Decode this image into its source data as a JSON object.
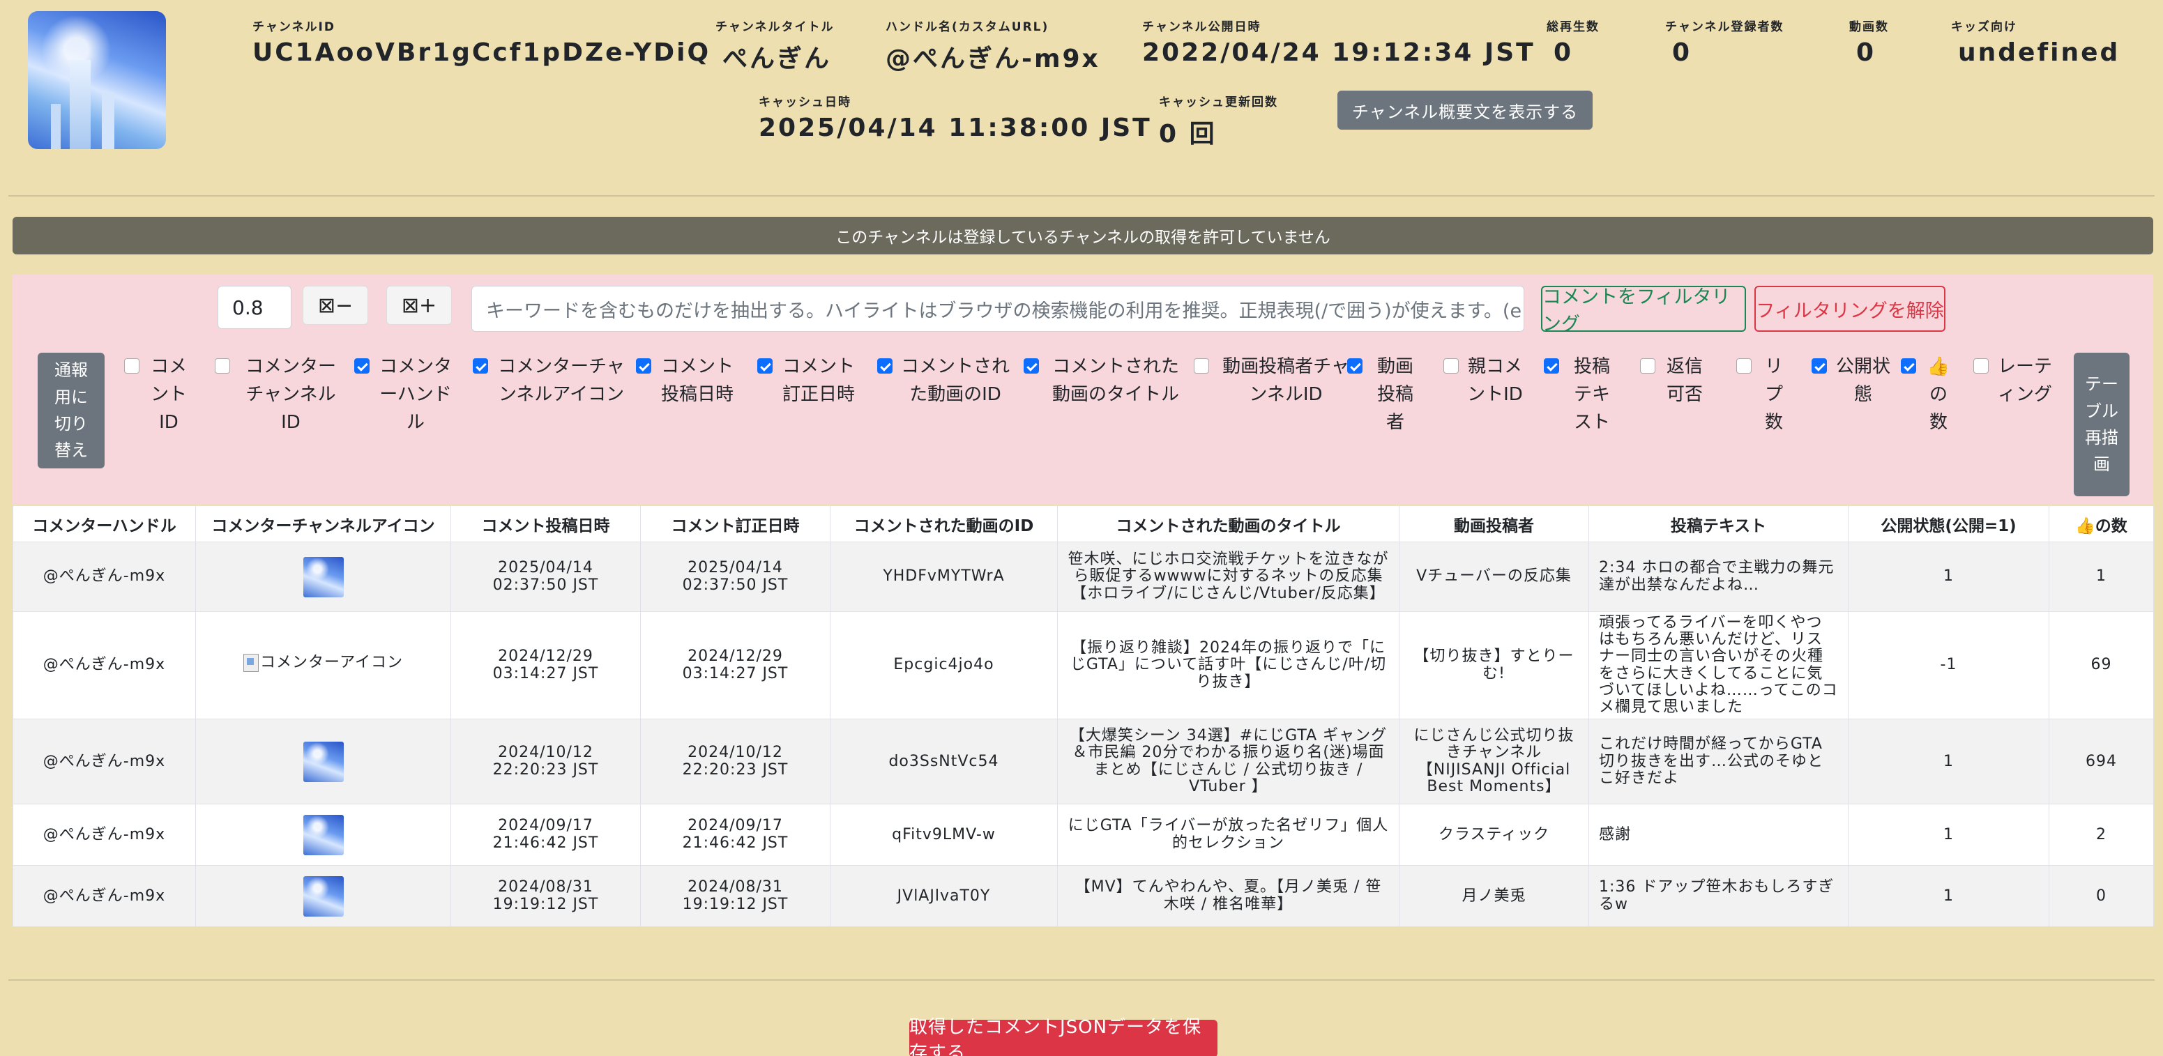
{
  "channel": {
    "id_label": "チャンネルID",
    "id": "UC1AooVBr1gCcf1pDZe-YDiQ",
    "title_label": "チャンネルタイトル",
    "title": "ぺんぎん",
    "handle_label": "ハンドル名(カスタムURL)",
    "handle": "@ぺんぎん-m9x",
    "published_label": "チャンネル公開日時",
    "published": "2022/04/24 19:12:34 JST",
    "views_label": "総再生数",
    "views": "0",
    "subs_label": "チャンネル登録者数",
    "subs": "0",
    "videos_label": "動画数",
    "videos": "0",
    "kids_label": "キッズ向け",
    "kids": "undefined",
    "cache_label": "キャッシュ日時",
    "cache": "2025/04/14 11:38:00 JST",
    "cache_count_label": "キャッシュ更新回数",
    "cache_count": "0 回",
    "about_button": "チャンネル概要文を表示する"
  },
  "banner": "このチャンネルは登録しているチャンネルの取得を許可していません",
  "filter": {
    "scale_value": "0.8",
    "minus_icon": "⊠−",
    "plus_icon": "⊠+",
    "keyword_placeholder": "キーワードを含むものだけを抽出する。ハイライトはブラウザの検索機能の利用を推奨。正規表現(/で囲う)が使えます。(e.g. /(BC|AD",
    "filter_button": "コメントをフィルタリング",
    "clear_button": "フィルタリングを解除",
    "report_toggle": "通報用に切り替え",
    "redraw_button": "テーブル再描画"
  },
  "columns_toggle": [
    {
      "label": "コメントID",
      "checked": false
    },
    {
      "label": "コメンターチャンネルID",
      "checked": false
    },
    {
      "label": "コメンターハンドル",
      "checked": true
    },
    {
      "label": "コメンターチャンネルアイコン",
      "checked": true
    },
    {
      "label": "コメント投稿日時",
      "checked": true
    },
    {
      "label": "コメント訂正日時",
      "checked": true
    },
    {
      "label": "コメントされた動画のID",
      "checked": true
    },
    {
      "label": "コメントされた動画のタイトル",
      "checked": true
    },
    {
      "label": "動画投稿者チャンネルID",
      "checked": false
    },
    {
      "label": "動画投稿者",
      "checked": true
    },
    {
      "label": "親コメントID",
      "checked": false
    },
    {
      "label": "投稿テキスト",
      "checked": true
    },
    {
      "label": "返信可否",
      "checked": false
    },
    {
      "label": "リプ数",
      "checked": false
    },
    {
      "label": "公開状態",
      "checked": true
    },
    {
      "label": "👍の数",
      "checked": true
    },
    {
      "label": "レーティング",
      "checked": false
    }
  ],
  "table": {
    "headers": [
      "コメンターハンドル",
      "コメンターチャンネルアイコン",
      "コメント投稿日時",
      "コメント訂正日時",
      "コメントされた動画のID",
      "コメントされた動画のタイトル",
      "動画投稿者",
      "投稿テキスト",
      "公開状態(公開=1)",
      "👍の数"
    ],
    "broken_icon_alt": "コメンターアイコン",
    "rows": [
      {
        "handle": "@ぺんぎん-m9x",
        "icon": "thumb",
        "posted": "2025/04/14\n02:37:50 JST",
        "edited": "2025/04/14\n02:37:50 JST",
        "video_id": "YHDFvMYTWrA",
        "video_title": "笹木咲、にじホロ交流戦チケットを泣きながら販促するwwwwに対するネットの反応集【ホロライブ/にじさんじ/Vtuber/反応集】",
        "uploader": "Vチューバーの反応集",
        "text": "2:34 ホロの都合で主戦力の舞元達が出禁なんだよね…",
        "public": "1",
        "likes": "1"
      },
      {
        "handle": "@ぺんぎん-m9x",
        "icon": "broken",
        "posted": "2024/12/29\n03:14:27 JST",
        "edited": "2024/12/29\n03:14:27 JST",
        "video_id": "Epcgic4jo4o",
        "video_title": "【振り返り雑談】2024年の振り返りで「にじGTA」について話す叶【にじさんじ/叶/切り抜き】",
        "uploader": "【切り抜き】すとりーむ!",
        "text": "頑張ってるライバーを叩くやつはもちろん悪いんだけど、リスナー同士の言い合いがその火種をさらに大きくしてることに気づいてほしいよね……ってこのコメ欄見て思いました",
        "public": "-1",
        "likes": "69"
      },
      {
        "handle": "@ぺんぎん-m9x",
        "icon": "thumb",
        "posted": "2024/10/12\n22:20:23 JST",
        "edited": "2024/10/12\n22:20:23 JST",
        "video_id": "do3SsNtVc54",
        "video_title": "【大爆笑シーン 34選】#にじGTA ギャング＆市民編 20分でわかる振り返り名(迷)場面まとめ【にじさんじ / 公式切り抜き / VTuber 】",
        "uploader": "にじさんじ公式切り抜きチャンネル【NIJISANJI Official Best Moments】",
        "text": "これだけ時間が経ってからGTA切り抜きを出す…公式のそゆとこ好きだよ",
        "public": "1",
        "likes": "694"
      },
      {
        "handle": "@ぺんぎん-m9x",
        "icon": "thumb",
        "posted": "2024/09/17\n21:46:42 JST",
        "edited": "2024/09/17\n21:46:42 JST",
        "video_id": "qFitv9LMV-w",
        "video_title": "にじGTA「ライバーが放った名ゼリフ」個人的セレクション",
        "uploader": "クラスティック",
        "text": "感謝",
        "public": "1",
        "likes": "2"
      },
      {
        "handle": "@ぺんぎん-m9x",
        "icon": "thumb",
        "posted": "2024/08/31\n19:19:12 JST",
        "edited": "2024/08/31\n19:19:12 JST",
        "video_id": "JVlAJlvaT0Y",
        "video_title": "【MV】てんやわんや、夏。【月ノ美兎 / 笹木咲 / 椎名唯華】",
        "uploader": "月ノ美兎",
        "text": "1:36 ドアップ笹木おもしろすぎるw",
        "public": "1",
        "likes": "0"
      }
    ]
  },
  "save_button": "取得したコメントJSONデータを保存する"
}
